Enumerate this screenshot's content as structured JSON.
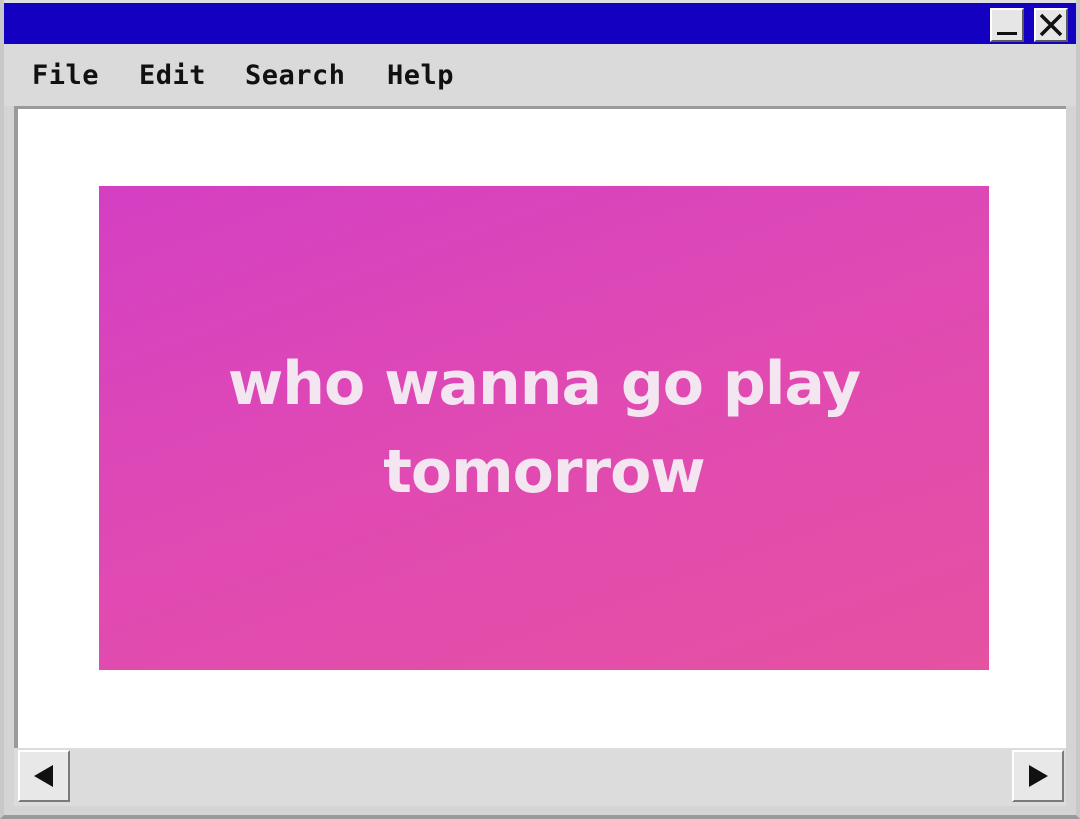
{
  "window": {
    "controls": {
      "minimize_icon": "minimize-icon",
      "close_icon": "close-icon"
    },
    "colors": {
      "titlebar": "#1400c0",
      "chrome": "#d4d4d4"
    }
  },
  "menu": {
    "items": [
      {
        "label": "File"
      },
      {
        "label": "Edit"
      },
      {
        "label": "Search"
      },
      {
        "label": "Help"
      }
    ]
  },
  "content": {
    "image": {
      "text_lines": [
        "who wanna go play",
        "tomorrow"
      ],
      "background_color": "#de48b6",
      "text_color": "#f3e6f0"
    }
  },
  "scrollbar": {
    "left_icon": "arrow-left-icon",
    "right_icon": "arrow-right-icon"
  }
}
